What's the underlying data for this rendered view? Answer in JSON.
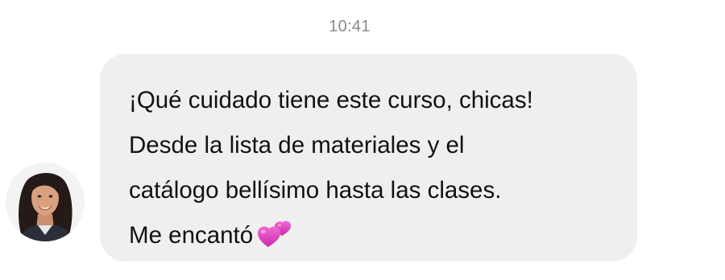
{
  "chat": {
    "timestamp": "10:41",
    "message": {
      "lines": [
        "¡Qué cuidado tiene este curso, chicas!",
        "Desde la lista de materiales y el",
        "catálogo bellísimo hasta las clases.",
        "Me encantó"
      ],
      "emoji": "two-hearts-icon"
    },
    "colors": {
      "bubble": "#efefef",
      "text": "#111111",
      "timestamp": "#8a8a8e",
      "heart": "#e23fc2"
    }
  }
}
